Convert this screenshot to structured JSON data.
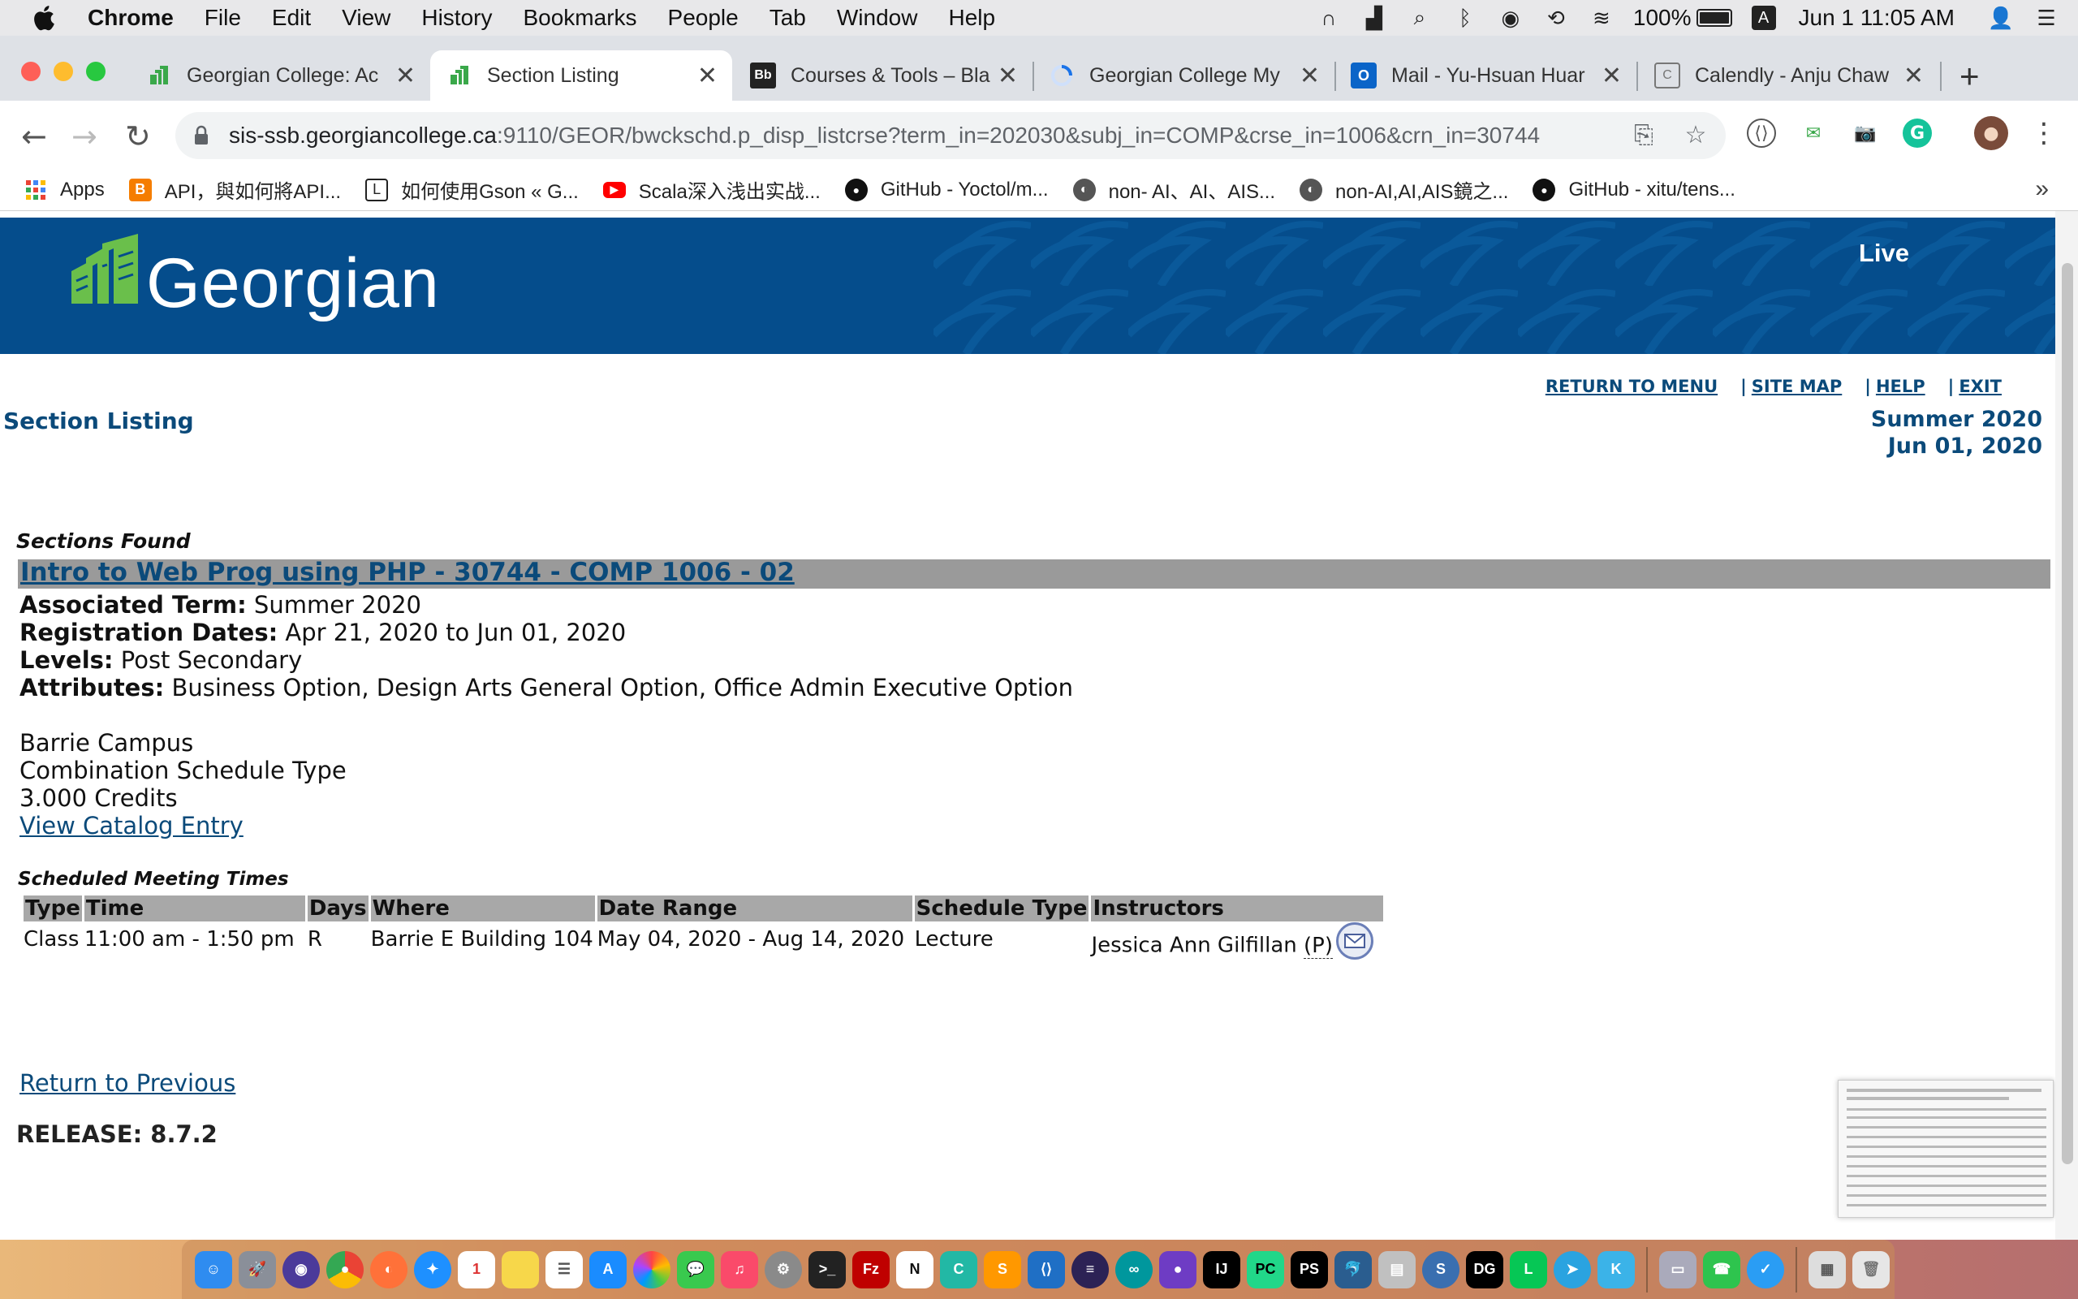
{
  "menubar": {
    "app": "Chrome",
    "items": [
      "File",
      "Edit",
      "View",
      "History",
      "Bookmarks",
      "People",
      "Tab",
      "Window",
      "Help"
    ],
    "battery": "100%",
    "input_source": "A",
    "clock": "Jun 1  11:05 AM"
  },
  "tabs": [
    {
      "title": "Georgian College: Ac",
      "active": false
    },
    {
      "title": "Section Listing",
      "active": true
    },
    {
      "title": "Courses & Tools – Bla",
      "active": false
    },
    {
      "title": "Georgian College My",
      "active": false
    },
    {
      "title": "Mail - Yu-Hsuan Huar",
      "active": false
    },
    {
      "title": "Calendly - Anju Chaw",
      "active": false
    }
  ],
  "omnibox": {
    "host": "sis-ssb.georgiancollege.ca",
    "path": ":9110/GEOR/bwckschd.p_disp_listcrse?term_in=202030&subj_in=COMP&crse_in=1006&crn_in=30744"
  },
  "bookmarks": [
    "Apps",
    "API，與如何將API...",
    "如何使用Gson « G...",
    "Scala深入浅出实战...",
    "GitHub - Yoctol/m...",
    "non- AI、AI、AIS...",
    "non-AI,AI,AIS鏡之...",
    "GitHub - xitu/tens..."
  ],
  "banner": {
    "logo_text": "Georgian",
    "env": "Live"
  },
  "toplinks": {
    "return_menu": "RETURN TO MENU",
    "site_map": "SITE MAP",
    "help": "HELP",
    "exit": "EXIT",
    "sep": "|"
  },
  "page": {
    "title": "Section Listing",
    "term": "Summer 2020",
    "date": "Jun 01, 2020",
    "sections_found": "Sections Found",
    "section_title": "Intro to Web Prog using PHP - 30744 - COMP 1006 - 02",
    "associated_term_label": "Associated Term:",
    "associated_term": "Summer 2020",
    "reg_dates_label": "Registration Dates:",
    "reg_dates": "Apr 21, 2020 to Jun 01, 2020",
    "levels_label": "Levels:",
    "levels": "Post Secondary",
    "attributes_label": "Attributes:",
    "attributes": "Business Option, Design Arts General Option, Office Admin Executive Option",
    "campus": "Barrie Campus",
    "schedule_type": "Combination Schedule Type",
    "credits": "3.000 Credits",
    "catalog_link": "View Catalog Entry",
    "meeting_times_caption": "Scheduled Meeting Times",
    "return_previous": "Return to Previous",
    "release": "RELEASE: 8.7.2"
  },
  "meeting_table": {
    "headers": [
      "Type",
      "Time",
      "Days",
      "Where",
      "Date Range",
      "Schedule Type",
      "Instructors"
    ],
    "rows": [
      {
        "type": "Class",
        "time": "11:00 am - 1:50 pm",
        "days": "R",
        "where": "Barrie E Building 104",
        "date_range": "May 04, 2020 - Aug 14, 2020",
        "schedule_type": "Lecture",
        "instructor": "Jessica Ann Gilfillan",
        "primary_marker": "(P)"
      }
    ]
  },
  "colors": {
    "banner": "#054d8c",
    "link": "#0b4a7a",
    "header_gray": "#a8a8a8",
    "green": "#6abf4b"
  }
}
